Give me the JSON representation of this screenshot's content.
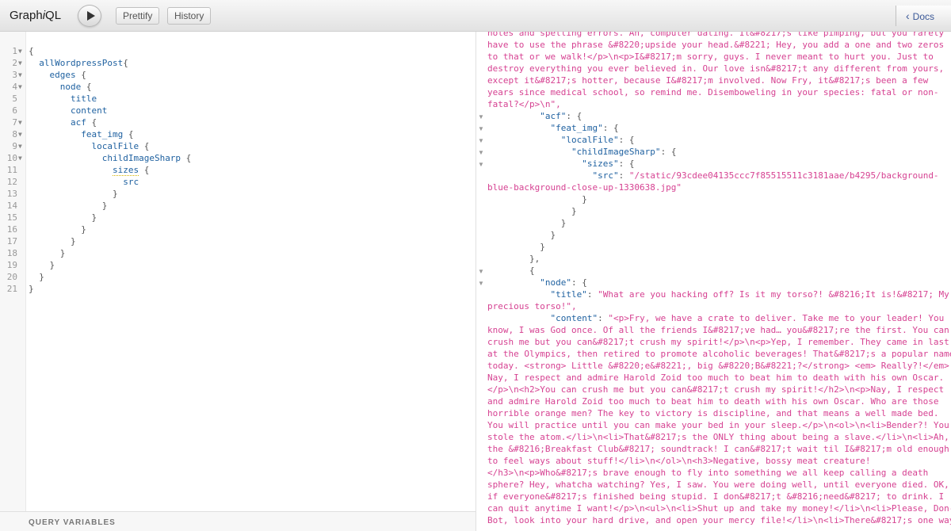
{
  "app": {
    "title_pre": "Graph",
    "title_i": "i",
    "title_post": "QL"
  },
  "toolbar": {
    "prettify_label": "Prettify",
    "history_label": "History",
    "docs_label": "Docs"
  },
  "query": {
    "lines": [
      {
        "n": "1",
        "t": "{"
      },
      {
        "n": "2",
        "t": "  allWordpressPost{"
      },
      {
        "n": "3",
        "t": "    edges {"
      },
      {
        "n": "4",
        "t": "      node {"
      },
      {
        "n": "5",
        "t": "        title"
      },
      {
        "n": "6",
        "t": "        content"
      },
      {
        "n": "7",
        "t": "        acf {"
      },
      {
        "n": "8",
        "t": "          feat_img {"
      },
      {
        "n": "9",
        "t": "            localFile {"
      },
      {
        "n": "10",
        "t": "              childImageSharp {"
      },
      {
        "n": "11",
        "t": "                sizes {"
      },
      {
        "n": "12",
        "t": "                  src"
      },
      {
        "n": "13",
        "t": "                }"
      },
      {
        "n": "14",
        "t": "              }"
      },
      {
        "n": "15",
        "t": "            }"
      },
      {
        "n": "16",
        "t": "          }"
      },
      {
        "n": "17",
        "t": "        }"
      },
      {
        "n": "18",
        "t": "      }"
      },
      {
        "n": "19",
        "t": "    }"
      },
      {
        "n": "20",
        "t": "  }"
      },
      {
        "n": "21",
        "t": "}"
      }
    ]
  },
  "variables_label": "QUERY VARIABLES",
  "result": {
    "lines": [
      "notes and spelling errors. Ah, computer dating. It&#8217;s like pimping, but you rarely",
      "have to use the phrase &#8220;upside your head.&#8221; Hey, you add a one and two zeros",
      "to that or we walk!</p>\\n<p>I&#8217;m sorry, guys. I never meant to hurt you. Just to",
      "destroy everything you ever believed in. Our love isn&#8217;t any different from yours,",
      "except it&#8217;s hotter, because I&#8217;m involved. Now Fry, it&#8217;s been a few",
      "years since medical school, so remind me. Disemboweling in your species: fatal or non-",
      "fatal?</p>\\n\",",
      "          \"acf\": {",
      "            \"feat_img\": {",
      "              \"localFile\": {",
      "                \"childImageSharp\": {",
      "                  \"sizes\": {",
      "                    \"src\": \"/static/93cdee04135ccc7f85515511c3181aae/b4295/background-",
      "blue-background-close-up-1330638.jpg\"",
      "                  }",
      "                }",
      "              }",
      "            }",
      "          }",
      "        },",
      "        {",
      "          \"node\": {",
      "            \"title\": \"What are you hacking off? Is it my torso?! &#8216;It is!&#8217; My",
      "precious torso!\",",
      "            \"content\": \"<p>Fry, we have a crate to deliver. Take me to your leader! You",
      "know, I was God once. Of all the friends I&#8217;ve had… you&#8217;re the first. You can",
      "crush me but you can&#8217;t crush my spirit!</p>\\n<p>Yep, I remember. They came in last",
      "at the Olympics, then retired to promote alcoholic beverages! That&#8217;s a popular name",
      "today. <strong> Little &#8220;e&#8221;, big &#8220;B&#8221;?</strong> <em> Really?!</em>",
      "Nay, I respect and admire Harold Zoid too much to beat him to death with his own Oscar.",
      "</p>\\n<h2>You can crush me but you can&#8217;t crush my spirit!</h2>\\n<p>Nay, I respect",
      "and admire Harold Zoid too much to beat him to death with his own Oscar. Who are those",
      "horrible orange men? The key to victory is discipline, and that means a well made bed.",
      "You will practice until you can make your bed in your sleep.</p>\\n<ol>\\n<li>Bender?! You",
      "stole the atom.</li>\\n<li>That&#8217;s the ONLY thing about being a slave.</li>\\n<li>Ah,",
      "the &#8216;Breakfast Club&#8217; soundtrack! I can&#8217;t wait til I&#8217;m old enough",
      "to feel ways about stuff!</li>\\n</ol>\\n<h3>Negative, bossy meat creature!",
      "</h3>\\n<p>Who&#8217;s brave enough to fly into something we all keep calling a death",
      "sphere? Hey, whatcha watching? Yes, I saw. You were doing well, until everyone died. OK,",
      "if everyone&#8217;s finished being stupid. I don&#8217;t &#8216;need&#8217; to drink. I",
      "can quit anytime I want!</p>\\n<ul>\\n<li>Shut up and take my money!</li>\\n<li>Please, Don-",
      "Bot, look into your hard drive, and open your mercy file!</li>\\n<li>There&#8217;s one way"
    ]
  }
}
